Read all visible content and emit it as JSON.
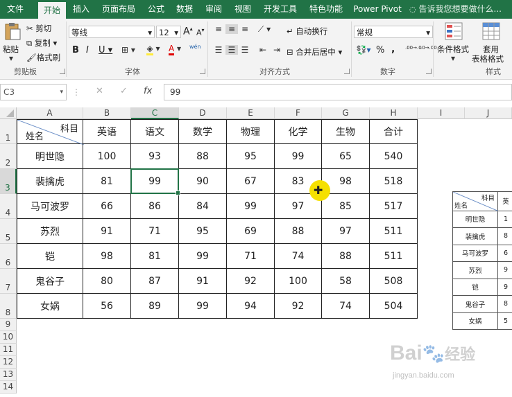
{
  "tabs": [
    "文件",
    "开始",
    "插入",
    "页面布局",
    "公式",
    "数据",
    "审阅",
    "视图",
    "开发工具",
    "特色功能",
    "Power Pivot"
  ],
  "active_tab": "开始",
  "tell_me": "告诉我您想要做什么...",
  "ribbon": {
    "clipboard": {
      "paste": "粘贴",
      "cut": "剪切",
      "copy": "复制",
      "format_painter": "格式刷",
      "label": "剪贴板"
    },
    "font": {
      "name": "等线",
      "size": "12",
      "grow": "A",
      "shrink": "A",
      "bold": "B",
      "italic": "I",
      "underline": "U",
      "label": "字体",
      "wen": "wén"
    },
    "alignment": {
      "wrap": "自动换行",
      "merge": "合并后居中",
      "label": "对齐方式"
    },
    "number": {
      "format": "常规",
      "percent": "%",
      "comma": ",",
      "inc_decimal": ".00→.0",
      "dec_decimal": ".0→.00",
      "label": "数字"
    },
    "styles": {
      "conditional": "条件格式",
      "table_line1": "套用",
      "table_line2": "表格格式",
      "label": "样式"
    }
  },
  "formula_bar": {
    "name_box": "C3",
    "cancel": "✕",
    "enter": "✓",
    "fx": "fx",
    "value": "99"
  },
  "columns": [
    "A",
    "B",
    "C",
    "D",
    "E",
    "F",
    "G",
    "H",
    "I",
    "J"
  ],
  "selected_column": "C",
  "selected_row": "3",
  "rows": [
    "1",
    "2",
    "3",
    "4",
    "5",
    "6",
    "7",
    "8",
    "9",
    "10",
    "11",
    "12",
    "13",
    "14"
  ],
  "table": {
    "corner_top": "科目",
    "corner_bottom": "姓名",
    "headers": [
      "英语",
      "语文",
      "数学",
      "物理",
      "化学",
      "生物",
      "合计"
    ],
    "data": [
      {
        "name": "明世隐",
        "values": [
          "100",
          "93",
          "88",
          "95",
          "99",
          "65",
          "540"
        ]
      },
      {
        "name": "裴擒虎",
        "values": [
          "81",
          "99",
          "90",
          "67",
          "83",
          "98",
          "518"
        ]
      },
      {
        "name": "马可波罗",
        "values": [
          "66",
          "86",
          "84",
          "99",
          "97",
          "85",
          "517"
        ]
      },
      {
        "name": "苏烈",
        "values": [
          "91",
          "71",
          "95",
          "69",
          "88",
          "97",
          "511"
        ]
      },
      {
        "name": "铠",
        "values": [
          "98",
          "81",
          "99",
          "71",
          "74",
          "88",
          "511"
        ]
      },
      {
        "name": "鬼谷子",
        "values": [
          "80",
          "87",
          "91",
          "92",
          "100",
          "58",
          "508"
        ]
      },
      {
        "name": "女娲",
        "values": [
          "56",
          "89",
          "99",
          "94",
          "92",
          "74",
          "504"
        ]
      }
    ]
  },
  "mini_table": {
    "corner_top": "科目",
    "corner_bottom": "姓名",
    "header_partial": "英",
    "names": [
      "明世隐",
      "裴擒虎",
      "马可波罗",
      "苏烈",
      "铠",
      "鬼谷子",
      "女娲"
    ],
    "partial_values": [
      "1",
      "8",
      "6",
      "9",
      "9",
      "8",
      "5"
    ]
  },
  "watermark": {
    "brand": "Bai",
    "brand2": "经验",
    "url": "jingyan.baidu.com"
  },
  "colors": {
    "excel_green": "#217346",
    "cursor_highlight": "#f5e000"
  }
}
